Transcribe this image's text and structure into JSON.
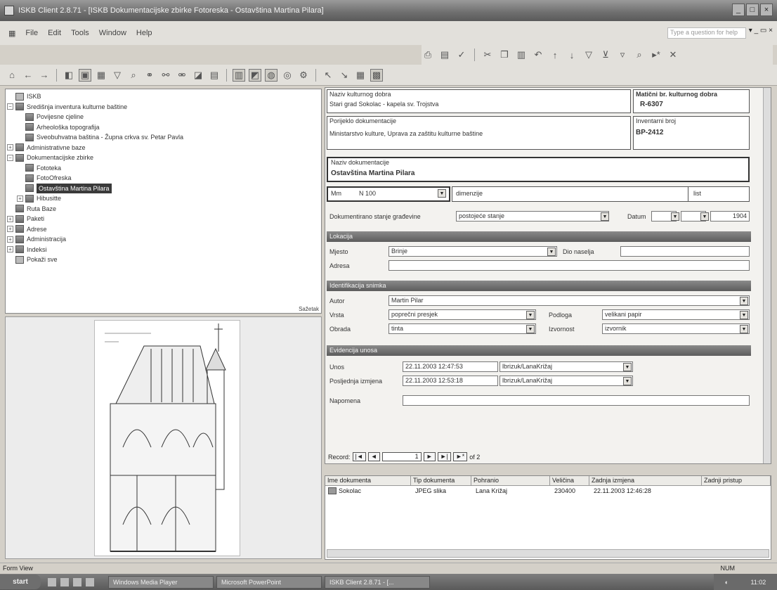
{
  "window": {
    "title": "ISKB Client 2.8.71 - [ISKB Dokumentacijske zbirke Fotoreska - Ostavština Martina Pilara]"
  },
  "menu": {
    "items": [
      "File",
      "Edit",
      "Tools",
      "Window",
      "Help"
    ],
    "help_placeholder": "Type a question for help"
  },
  "tree": {
    "root": "ISKB",
    "items": [
      "Središnja inventura kulturne baštine",
      "Povijesne cjeline",
      "Arheološka topografija",
      "Sveobuhvatna baština - Župna crkva sv. Petar Pavla",
      "Administrativne baze",
      "Dokumentacijske zbirke",
      "Fototeka",
      "FotoOfreska",
      "Ostavština Martina Pilara",
      "Hibusitte",
      "Ruta Baze",
      "Paketi",
      "Adrese",
      "Administracija",
      "Indeksi",
      "Pokaži sve"
    ],
    "side_label": "Sažetak"
  },
  "form": {
    "naziv_dobra_label": "Naziv kulturnog dobra",
    "naziv_dobra_value": "Stari grad Sokolac - kapela sv. Trojstva",
    "reg_br_label": "Matični br. kulturnog dobra",
    "reg_br_value": "R-6307",
    "porijeklo_label": "Porijeklo dokumentacije",
    "porijeklo_value": "Ministarstvo kulture, Uprava za zaštitu kulturne baštine",
    "inv_br_label": "Inventarni broj",
    "inv_br_value": "BP-2412",
    "naziv_dok_label": "Naziv dokumentacije",
    "naziv_dok_value": "Ostavština Martina Pilara",
    "mm_label": "Mm",
    "mm_value": "N 100",
    "dimenzije_label": "dimenzije",
    "list_label": "list",
    "dok_stanje_label": "Dokumentirano stanje građevine",
    "dok_stanje_value": "postojeće stanje",
    "datum_label": "Datum",
    "datum_year": "1904",
    "lokacija_header": "Lokacija",
    "mjesto_label": "Mjesto",
    "mjesto_value": "Brinje",
    "dio_naselja_label": "Dio naselja",
    "adresa_label": "Adresa",
    "ident_header": "Identifikacija snimka",
    "autor_label": "Autor",
    "autor_value": "Martin Pilar",
    "vrsta_label": "Vrsta",
    "vrsta_value": "poprečni presjek",
    "podloga_label": "Podloga",
    "podloga_value": "velikani papir",
    "obrada_label": "Obrada",
    "obrada_value": "tinta",
    "izvornost_label": "Izvornost",
    "izvornost_value": "izvornik",
    "evid_header": "Evidencija unosa",
    "unos_label": "Unos",
    "unos_value": "22.11.2003 12:47:53",
    "unos_user": "lbrizuk/LanaKrižaj",
    "posljednja_label": "Posljednja izmjena",
    "posljednja_value": "22.11.2003 12:53:18",
    "posljednja_user": "lbrizuk/LanaKrižaj",
    "napomena_label": "Napomena",
    "record_label": "Record:",
    "record_num": "1",
    "record_of": "of 2"
  },
  "docs": {
    "headers": [
      "Ime dokumenta",
      "Tip dokumenta",
      "Pohranio",
      "Veličina",
      "Zadnja izmjena",
      "Zadnji pristup"
    ],
    "rows": [
      {
        "name": "Sokolac",
        "type": "JPEG slika",
        "by": "Lana Križaj",
        "size": "230400",
        "modified": "22.11.2003 12:46:28",
        "accessed": ""
      }
    ]
  },
  "status": {
    "left": "Form View",
    "right": "NUM"
  },
  "taskbar": {
    "start": "start",
    "tasks": [
      "Windows Media Player",
      "Microsoft PowerPoint",
      "ISKB Client 2.8.71 - [..."
    ],
    "clock": "11:02"
  }
}
